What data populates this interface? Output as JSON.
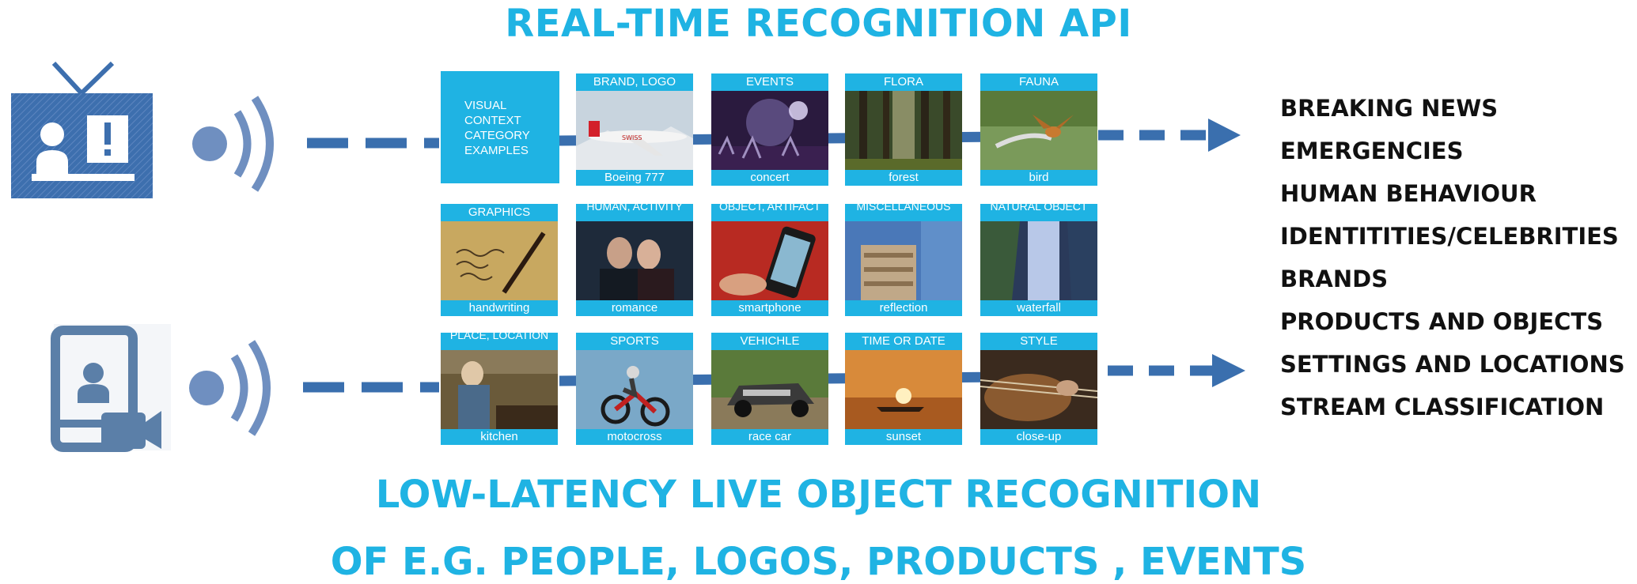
{
  "header": {
    "title": "REAL-TIME RECOGNITION API"
  },
  "footer": {
    "line1": "LOW-LATENCY LIVE OBJECT RECOGNITION",
    "line2": "OF E.G. PEOPLE, LOGOS, PRODUCTS , EVENTS"
  },
  "intro_box": {
    "lines": [
      "VISUAL",
      "CONTEXT",
      "CATEGORY",
      "EXAMPLES"
    ]
  },
  "tiles": [
    {
      "category": "BRAND, LOGO",
      "example": "Boeing 777"
    },
    {
      "category": "EVENTS",
      "example": "concert"
    },
    {
      "category": "FLORA",
      "example": "forest"
    },
    {
      "category": "FAUNA",
      "example": "bird"
    },
    {
      "category": "GRAPHICS",
      "example": "handwriting"
    },
    {
      "category": "HUMAN, ACTIVITY",
      "example": "romance"
    },
    {
      "category": "OBJECT, ARTIFACT",
      "example": "smartphone"
    },
    {
      "category": "MISCELLANEOUS",
      "example": "reflection"
    },
    {
      "category": "NATURAL OBJECT",
      "example": "waterfall"
    },
    {
      "category": "PLACE, LOCATION",
      "example": "kitchen"
    },
    {
      "category": "SPORTS",
      "example": "motocross"
    },
    {
      "category": "VEHICHLE",
      "example": "race car"
    },
    {
      "category": "TIME OR DATE",
      "example": "sunset"
    },
    {
      "category": "STYLE",
      "example": "close-up"
    }
  ],
  "output_categories": [
    "BREAKING NEWS",
    "EMERGENCIES",
    "HUMAN BEHAVIOUR",
    "IDENTITITIES/CELEBRITIES",
    "BRANDS",
    "PRODUCTS AND OBJECTS",
    "SETTINGS AND LOCATIONS",
    "STREAM CLASSIFICATION"
  ],
  "icons": {
    "tv": "tv-alert-icon",
    "tablet": "tablet-video-icon",
    "signal": "broadcast-signal-icon"
  },
  "colors": {
    "accent": "#1fb3e3",
    "icon": "#3d6fae",
    "signal": "#6f8fc0",
    "arrow": "#3a6fae"
  }
}
